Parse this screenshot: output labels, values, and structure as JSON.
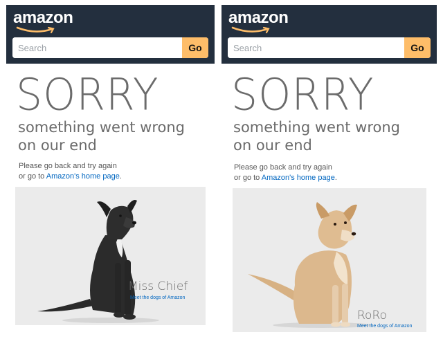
{
  "colors": {
    "header_bg": "#232f3e",
    "go_button": "#febd69",
    "link": "#0066c0",
    "heading_gray": "#6b6b6b",
    "card_bg": "#ebebeb"
  },
  "icons": [
    "amazon-smile-icon",
    "dog-illustration"
  ],
  "panels": [
    {
      "header": {
        "logo": "amazon",
        "search_placeholder": "Search",
        "go_label": "Go"
      },
      "error": {
        "title": "SORRY",
        "subtitle_line1": "something went wrong",
        "subtitle_line2": "on our end",
        "message_line1": "Please go back and try again",
        "message_line2_prefix": "or go to ",
        "message_link": "Amazon's home page",
        "message_line2_suffix": "."
      },
      "dog": {
        "name": "Miss Chief",
        "caption": "Meet the dogs of Amazon"
      }
    },
    {
      "header": {
        "logo": "amazon",
        "search_placeholder": "Search",
        "go_label": "Go"
      },
      "error": {
        "title": "SORRY",
        "subtitle_line1": "something went wrong",
        "subtitle_line2": "on our end",
        "message_line1": "Please go back and try again",
        "message_line2_prefix": "or go to ",
        "message_link": "Amazon's home page",
        "message_line2_suffix": "."
      },
      "dog": {
        "name": "RoRo",
        "caption": "Meet the dogs of Amazon"
      }
    }
  ]
}
